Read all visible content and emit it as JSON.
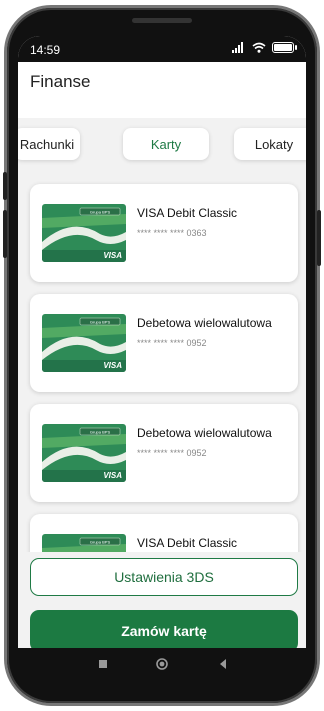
{
  "status_bar": {
    "time": "14:59",
    "icons": [
      "signal-icon",
      "wifi-icon",
      "battery-icon"
    ],
    "battery_label": "100"
  },
  "header": {
    "title": "Finanse"
  },
  "tabs": [
    {
      "label": "Rachunki",
      "active": false
    },
    {
      "label": "Karty",
      "active": true
    },
    {
      "label": "Lokaty",
      "active": false
    }
  ],
  "cards": [
    {
      "name": "VISA Debit Classic",
      "number": "**** **** **** 0363"
    },
    {
      "name": "Debetowa wielowalutowa",
      "number": "**** **** **** 0952"
    },
    {
      "name": "Debetowa wielowalutowa",
      "number": "**** **** **** 0952"
    },
    {
      "name": "VISA Debit Classic",
      "number": ""
    }
  ],
  "card_brand": {
    "bank_label": "Grupa BPS",
    "network": "VISA"
  },
  "actions": {
    "settings_3ds": "Ustawienia 3DS",
    "order_card": "Zamów kartę"
  },
  "navigation": {
    "buttons": [
      "recent-apps-icon",
      "home-icon",
      "back-icon"
    ]
  },
  "colors": {
    "accent": "#1f7a45",
    "button_fill": "#1c7a42",
    "background": "#f2f2f2"
  }
}
